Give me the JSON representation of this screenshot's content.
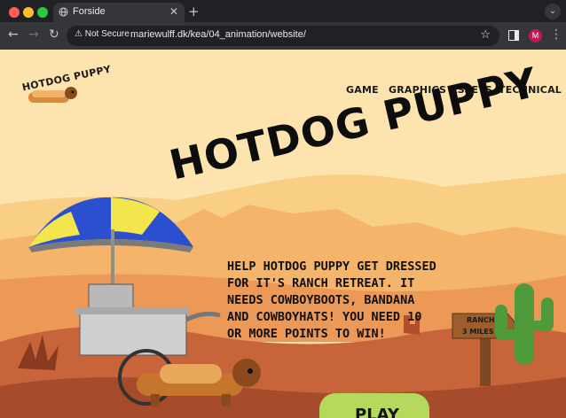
{
  "browser": {
    "tab_title": "Forside",
    "tab_close": "✕",
    "new_tab": "+",
    "not_secure": "Not Secure",
    "url": "mariewulff.dk/kea/04_animation/website/",
    "profile_initial": "M",
    "colors": {
      "close": "#ff5f57",
      "minimize": "#febc2e",
      "maximize": "#28c840"
    }
  },
  "site": {
    "logo": "HOTDOG PUPPY",
    "nav": [
      "GAME",
      "GRAPHICS",
      "ASSETS",
      "TECHNICAL"
    ],
    "title": "HOTDOG PUPPY",
    "description": "HELP HOTDOG PUPPY GET DRESSED FOR IT'S RANCH RETREAT. IT NEEDS COWBOYBOOTS, BANDANA AND COWBOYHATS! YOU NEED 10 OR MORE POINTS TO WIN!",
    "sign_line1": "RANCH",
    "sign_line2": "3 MILES",
    "play_label": "PLAY"
  }
}
